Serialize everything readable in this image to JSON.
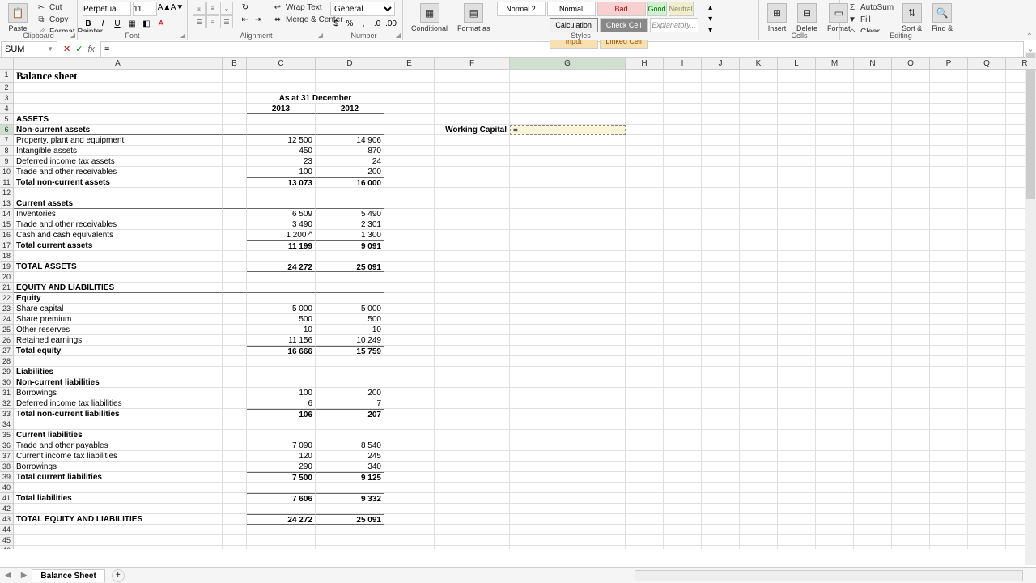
{
  "ribbon": {
    "clipboard": {
      "label": "Clipboard",
      "paste": "Paste",
      "cut": "Cut",
      "copy": "Copy",
      "fmtpainter": "Format Painter"
    },
    "font": {
      "label": "Font",
      "name": "Perpetua",
      "size": "11"
    },
    "alignment": {
      "label": "Alignment",
      "wrap": "Wrap Text",
      "merge": "Merge & Center"
    },
    "number": {
      "label": "Number",
      "format": "General"
    },
    "styles": {
      "label": "Styles",
      "cond": "Conditional\nFormatting",
      "table": "Format as\nTable",
      "cells": [
        "Normal 2",
        "Normal",
        "Bad",
        "Good",
        "Neutral",
        "Calculation",
        "Check Cell",
        "Explanatory...",
        "Input",
        "Linked Cell"
      ]
    },
    "cellsGroup": {
      "label": "Cells",
      "insert": "Insert",
      "delete": "Delete",
      "format": "Format"
    },
    "editing": {
      "label": "Editing",
      "autosum": "AutoSum",
      "fill": "Fill",
      "clear": "Clear",
      "sort": "Sort &\nFilter",
      "find": "Find &\nSelect"
    }
  },
  "fbar": {
    "name": "SUM",
    "formula": "="
  },
  "columns": [
    "A",
    "B",
    "C",
    "D",
    "E",
    "F",
    "G",
    "H",
    "I",
    "J",
    "K",
    "L",
    "M",
    "N",
    "O",
    "P",
    "Q",
    "R"
  ],
  "activeCol": "G",
  "activeRow": 6,
  "title": "Balance sheet",
  "headerLine": "As at 31 December",
  "year1": "2013",
  "year2": "2012",
  "sideLabel": "Working Capital",
  "sideFormula": "=",
  "rows": {
    "assets": "ASSETS",
    "nca": "Non-current assets",
    "ppe": {
      "l": "Property, plant and equipment",
      "c": "12 500",
      "d": "14 906"
    },
    "int": {
      "l": "Intangible assets",
      "c": "450",
      "d": "870"
    },
    "dit": {
      "l": "Deferred income tax assets",
      "c": "23",
      "d": "24"
    },
    "tor": {
      "l": "Trade and other receivables",
      "c": "100",
      "d": "200"
    },
    "tnca": {
      "l": "Total non-current assets",
      "c": "13 073",
      "d": "16 000"
    },
    "ca": "Current assets",
    "inv": {
      "l": "Inventories",
      "c": "6 509",
      "d": "5 490"
    },
    "tor2": {
      "l": "Trade and other receivables",
      "c": "3 490",
      "d": "2 301"
    },
    "cash": {
      "l": "Cash and cash equivalents",
      "c": "1 200",
      "d": "1 300"
    },
    "tca": {
      "l": "Total current assets",
      "c": "11 199",
      "d": "9 091"
    },
    "ta": {
      "l": "TOTAL ASSETS",
      "c": "24 272",
      "d": "25 091"
    },
    "el": "EQUITY AND LIABILITIES",
    "eq": "Equity",
    "sc": {
      "l": "Share capital",
      "c": "5 000",
      "d": "5 000"
    },
    "sp": {
      "l": "Share premium",
      "c": "500",
      "d": "500"
    },
    "or": {
      "l": "Other reserves",
      "c": "10",
      "d": "10"
    },
    "re": {
      "l": "Retained earnings",
      "c": "11 156",
      "d": "10 249"
    },
    "te": {
      "l": "Total equity",
      "c": "16 666",
      "d": "15 759"
    },
    "liab": "Liabilities",
    "ncl": "Non-current liabilities",
    "bor": {
      "l": "Borrowings",
      "c": "100",
      "d": "200"
    },
    "ditl": {
      "l": "Deferred income tax liabilities",
      "c": "6",
      "d": "7"
    },
    "tncl": {
      "l": "Total non-current liabilities",
      "c": "106",
      "d": "207"
    },
    "cl": "Current liabilities",
    "top": {
      "l": "Trade and other payables",
      "c": "7 090",
      "d": "8 540"
    },
    "citl": {
      "l": "Current income tax liabilities",
      "c": "120",
      "d": "245"
    },
    "bor2": {
      "l": "Borrowings",
      "c": "290",
      "d": "340"
    },
    "tcl": {
      "l": "Total current liabilities",
      "c": "7 500",
      "d": "9 125"
    },
    "tl": {
      "l": "Total liabilities",
      "c": "7 606",
      "d": "9 332"
    },
    "tel": {
      "l": "TOTAL EQUITY AND LIABILITIES",
      "c": "24 272",
      "d": "25 091"
    }
  },
  "sheetTab": "Balance Sheet",
  "cursorMark": "↗"
}
